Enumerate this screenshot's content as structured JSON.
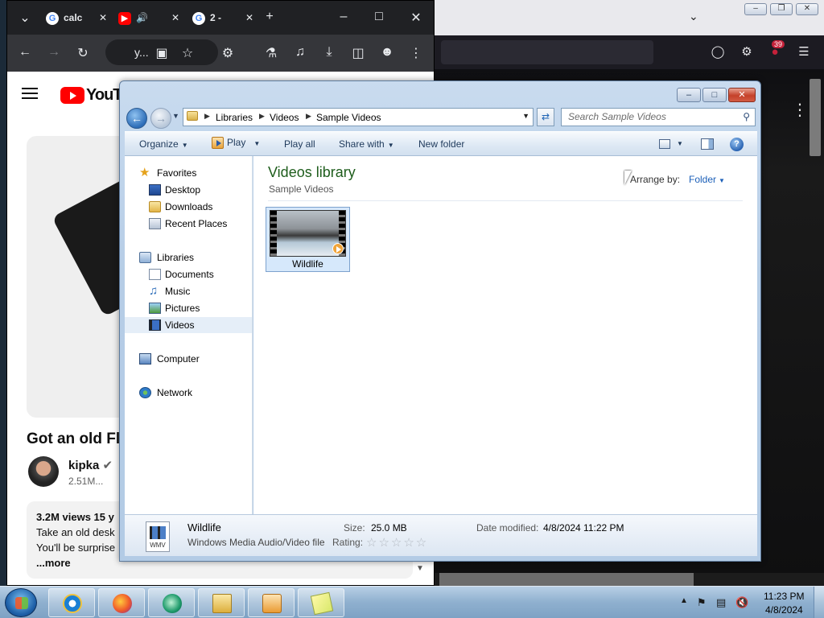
{
  "chrome": {
    "tabs": [
      {
        "label": "calc",
        "icon": "google-icon"
      },
      {
        "label": "",
        "icon": "youtube-icon"
      },
      {
        "label": "2 -",
        "icon": "google-icon"
      }
    ],
    "omnibox": "y..."
  },
  "youtube": {
    "video_title": "Got an old Fla",
    "channel": "kipka",
    "subscribers": "2.51M...",
    "views_line": "3.2M views  15 y",
    "desc_line1": "Take an old desk",
    "desc_line2": "You'll be surprise",
    "more": "...more"
  },
  "firefox": {
    "badge": "39"
  },
  "explorer": {
    "breadcrumb": [
      "Libraries",
      "Videos",
      "Sample Videos"
    ],
    "search_placeholder": "Search Sample Videos",
    "toolbar": {
      "organize": "Organize",
      "play": "Play",
      "play_all": "Play all",
      "share_with": "Share with",
      "new_folder": "New folder"
    },
    "nav": {
      "favorites": "Favorites",
      "desktop": "Desktop",
      "downloads": "Downloads",
      "recent_places": "Recent Places",
      "libraries": "Libraries",
      "documents": "Documents",
      "music": "Music",
      "pictures": "Pictures",
      "videos": "Videos",
      "computer": "Computer",
      "network": "Network"
    },
    "content": {
      "title": "Videos library",
      "subtitle": "Sample Videos",
      "arrange_label": "Arrange by:",
      "arrange_value": "Folder",
      "items": [
        {
          "name": "Wildlife"
        }
      ]
    },
    "details": {
      "name": "Wildlife",
      "type": "Windows Media Audio/Video file",
      "icon_ext": "WMV",
      "size_label": "Size:",
      "size_value": "25.0 MB",
      "rating_label": "Rating:",
      "rating_stars": "☆☆☆☆☆",
      "date_label": "Date modified:",
      "date_value": "4/8/2024 11:22 PM"
    }
  },
  "taskbar": {
    "time": "11:23 PM",
    "date": "4/8/2024"
  }
}
